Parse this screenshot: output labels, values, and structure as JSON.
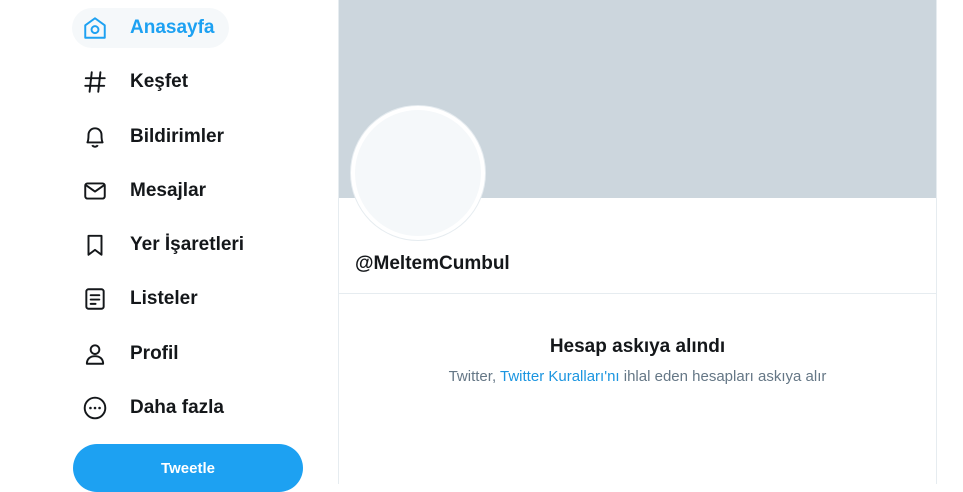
{
  "sidebar": {
    "items": [
      {
        "label": "Anasayfa",
        "icon": "home-icon",
        "active": true
      },
      {
        "label": "Keşfet",
        "icon": "hashtag-icon"
      },
      {
        "label": "Bildirimler",
        "icon": "bell-icon"
      },
      {
        "label": "Mesajlar",
        "icon": "mail-icon"
      },
      {
        "label": "Yer İşaretleri",
        "icon": "bookmark-icon"
      },
      {
        "label": "Listeler",
        "icon": "list-icon"
      },
      {
        "label": "Profil",
        "icon": "person-icon"
      },
      {
        "label": "Daha fazla",
        "icon": "more-icon"
      }
    ],
    "tweet_label": "Tweetle"
  },
  "profile": {
    "handle": "@MeltemCumbul"
  },
  "suspended": {
    "title": "Hesap askıya alındı",
    "text_prefix": "Twitter, ",
    "link_text": "Twitter Kuralları'nı",
    "text_suffix": " ihlal eden hesapları askıya alır"
  },
  "colors": {
    "accent": "#1da1f2",
    "banner": "#ccd6dd",
    "text": "#14171a",
    "secondary_text": "#657786"
  }
}
